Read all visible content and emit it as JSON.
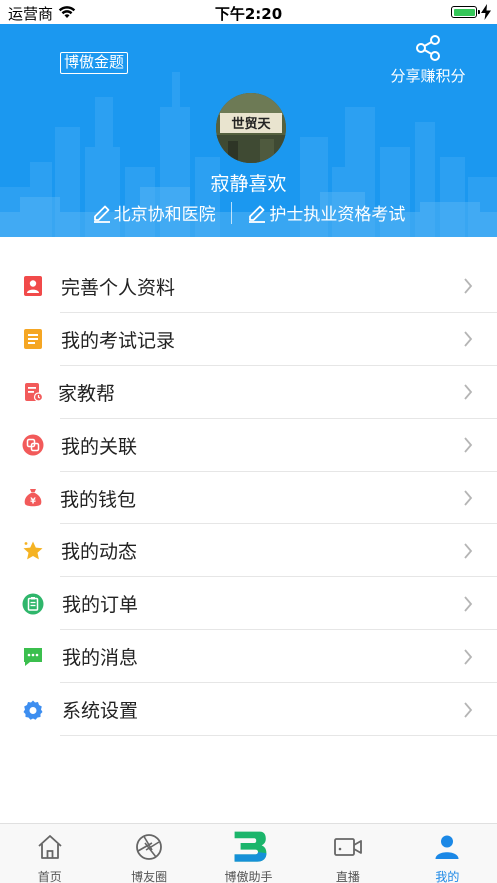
{
  "status_bar": {
    "carrier": "运营商",
    "time": "下午2:20",
    "battery_level": 1.0
  },
  "header": {
    "brand": "博傲金题",
    "share_label": "分享赚积分",
    "avatar_sign_text": "世贸天",
    "username": "寂静喜欢",
    "tags": [
      {
        "label": "北京协和医院"
      },
      {
        "label": "护士执业资格考试"
      }
    ],
    "background_color": "#1b98f0"
  },
  "menu": {
    "items": [
      {
        "label": "完善个人资料",
        "icon": "profile-icon",
        "color": "#f14a4a"
      },
      {
        "label": "我的考试记录",
        "icon": "exam-record-icon",
        "color": "#f5a623"
      },
      {
        "label": "家教帮",
        "icon": "tutor-icon",
        "color": "#f25a5a"
      },
      {
        "label": "我的关联",
        "icon": "link-icon",
        "color": "#f25a5a"
      },
      {
        "label": "我的钱包",
        "icon": "wallet-icon",
        "color": "#f25a5a"
      },
      {
        "label": "我的动态",
        "icon": "star-icon",
        "color": "#f5b323"
      },
      {
        "label": "我的订单",
        "icon": "order-icon",
        "color": "#2fb66b"
      },
      {
        "label": "我的消息",
        "icon": "message-icon",
        "color": "#3bbf4e"
      },
      {
        "label": "系统设置",
        "icon": "settings-icon",
        "color": "#3d8ef0"
      }
    ]
  },
  "tab_bar": {
    "items": [
      {
        "label": "首页",
        "icon": "home-icon",
        "active": false
      },
      {
        "label": "博友圈",
        "icon": "aperture-icon",
        "active": false
      },
      {
        "label": "博傲助手",
        "icon": "assistant-logo-icon",
        "active": false
      },
      {
        "label": "直播",
        "icon": "video-icon",
        "active": false
      },
      {
        "label": "我的",
        "icon": "user-icon",
        "active": true
      }
    ],
    "active_color": "#1b88e6"
  }
}
